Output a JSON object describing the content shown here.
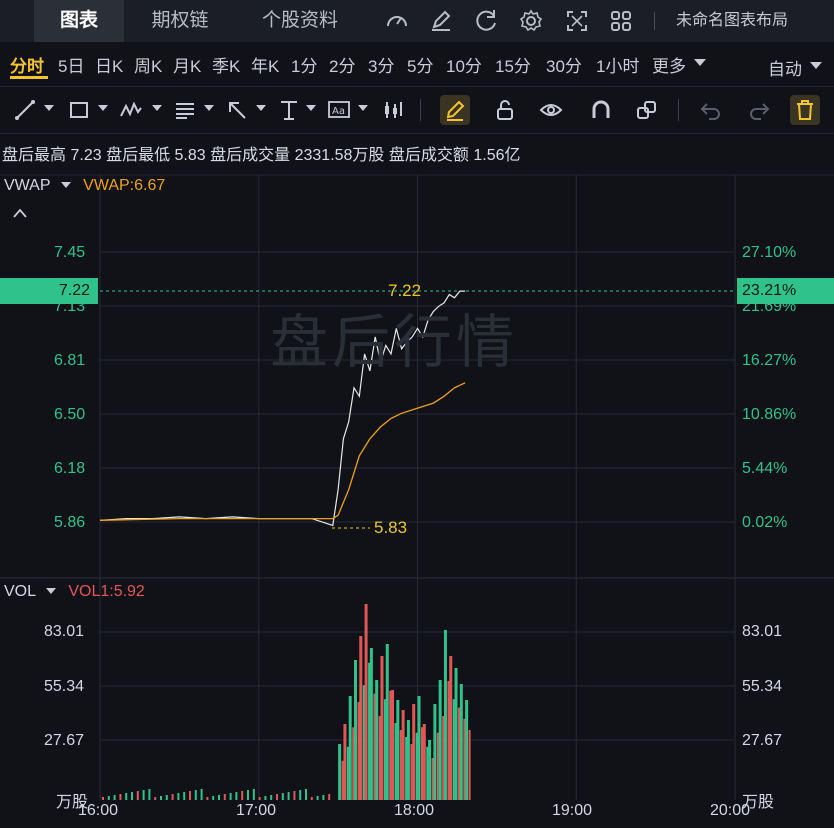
{
  "top_tabs": [
    {
      "label": "图表",
      "active": true
    },
    {
      "label": "期权链",
      "active": false
    },
    {
      "label": "个股资料",
      "active": false
    }
  ],
  "top_icons": [
    "gauge-icon",
    "edit-icon",
    "refresh-icon",
    "settings-icon",
    "fullscreen-icon",
    "grid-icon"
  ],
  "layout_label": "未命名图表布局",
  "periods": [
    "分时",
    "5日",
    "日K",
    "周K",
    "月K",
    "季K",
    "年K",
    "1分",
    "2分",
    "3分",
    "5分",
    "10分",
    "15分",
    "30分",
    "1小时",
    "更多"
  ],
  "active_period": "分时",
  "auto_label": "自动",
  "toolbar_icons": [
    "line-draw-icon",
    "rect-icon",
    "pattern-icon",
    "fib-icon",
    "arrow-icon",
    "measure-icon",
    "text-icon",
    "bar-icon",
    "pencil-icon",
    "lock-icon",
    "eye-icon",
    "magnet-icon",
    "layers-icon",
    "undo-icon",
    "redo-icon",
    "delete-icon"
  ],
  "stats": {
    "high_label": "盘后最高",
    "high": "7.23",
    "low_label": "盘后最低",
    "low": "5.83",
    "vol_label": "盘后成交量",
    "vol": "2331.58万股",
    "amt_label": "盘后成交额",
    "amt": "1.56亿"
  },
  "vwap_panel": {
    "name": "VWAP",
    "value_label": "VWAP:6.67"
  },
  "watermark": "盘后行情",
  "price_axis_left": [
    "7.45",
    "7.13",
    "6.81",
    "6.50",
    "6.18",
    "5.86"
  ],
  "price_axis_right": [
    "27.10%",
    "21.69%",
    "16.27%",
    "10.86%",
    "5.44%",
    "0.02%"
  ],
  "current_price_tag": "7.22",
  "current_pct_tag": "23.21%",
  "annotation_high": "7.22",
  "annotation_low": "5.83",
  "vol_panel": {
    "name": "VOL",
    "value_label": "VOL1:5.92",
    "unit": "万股"
  },
  "vol_axis": [
    "83.01",
    "55.34",
    "27.67"
  ],
  "time_axis": [
    "16:00",
    "17:00",
    "18:00",
    "19:00",
    "20:00"
  ],
  "colors": {
    "up": "#2fc28a",
    "down": "#e05757",
    "accent": "#f4c430",
    "vwap": "#f0a020",
    "price_line": "#e8e8e8"
  },
  "chart_data": [
    {
      "type": "line",
      "title": "",
      "xlabel": "",
      "ylabel": "",
      "ylim": [
        5.83,
        7.52
      ],
      "x_range": [
        "16:00",
        "20:00"
      ],
      "series": [
        {
          "name": "",
          "x": [
            "16:00",
            "16:10",
            "16:20",
            "16:30",
            "16:40",
            "16:50",
            "17:00",
            "17:10",
            "17:20",
            "17:28",
            "17:30",
            "17:32",
            "17:34",
            "17:36",
            "17:38",
            "17:40",
            "17:42",
            "17:44",
            "17:46",
            "17:48",
            "17:50",
            "17:52",
            "17:54",
            "17:56",
            "17:58",
            "18:00",
            "18:02",
            "18:04",
            "18:06",
            "18:08",
            "18:10",
            "18:12",
            "18:14",
            "18:16",
            "18:18"
          ],
          "values": [
            5.87,
            5.88,
            5.88,
            5.89,
            5.88,
            5.89,
            5.88,
            5.88,
            5.88,
            5.84,
            6.05,
            6.35,
            6.45,
            6.65,
            6.6,
            6.85,
            6.75,
            6.95,
            6.8,
            6.9,
            6.85,
            7.0,
            6.88,
            6.92,
            6.95,
            7.0,
            6.95,
            7.05,
            7.1,
            7.13,
            7.15,
            7.2,
            7.18,
            7.22,
            7.22
          ]
        },
        {
          "name": "VWAP",
          "x": [
            "16:00",
            "16:30",
            "17:00",
            "17:28",
            "17:30",
            "17:34",
            "17:38",
            "17:42",
            "17:46",
            "17:50",
            "17:54",
            "17:58",
            "18:02",
            "18:06",
            "18:10",
            "18:14",
            "18:18"
          ],
          "values": [
            5.87,
            5.88,
            5.88,
            5.88,
            5.9,
            6.05,
            6.25,
            6.35,
            6.42,
            6.47,
            6.5,
            6.52,
            6.54,
            6.56,
            6.6,
            6.65,
            6.68
          ]
        }
      ]
    },
    {
      "type": "bar",
      "title": "",
      "ylabel": "万股",
      "ylim": [
        0,
        100
      ],
      "series": [
        {
          "name": "",
          "x": [
            "17:30",
            "17:32",
            "17:34",
            "17:36",
            "17:38",
            "17:40",
            "17:42",
            "17:44",
            "17:46",
            "17:48",
            "17:50",
            "17:52",
            "17:54",
            "17:56",
            "17:58",
            "18:00",
            "18:02",
            "18:04",
            "18:06",
            "18:08",
            "18:10",
            "18:12",
            "18:14",
            "18:16",
            "18:18"
          ],
          "values": [
            28,
            38,
            52,
            70,
            82,
            98,
            76,
            60,
            72,
            78,
            55,
            50,
            45,
            40,
            48,
            52,
            38,
            30,
            48,
            60,
            85,
            72,
            66,
            58,
            50
          ],
          "up": [
            true,
            false,
            true,
            true,
            false,
            false,
            true,
            true,
            false,
            true,
            false,
            true,
            false,
            true,
            false,
            true,
            false,
            true,
            true,
            true,
            true,
            false,
            true,
            true,
            true
          ]
        }
      ]
    }
  ]
}
